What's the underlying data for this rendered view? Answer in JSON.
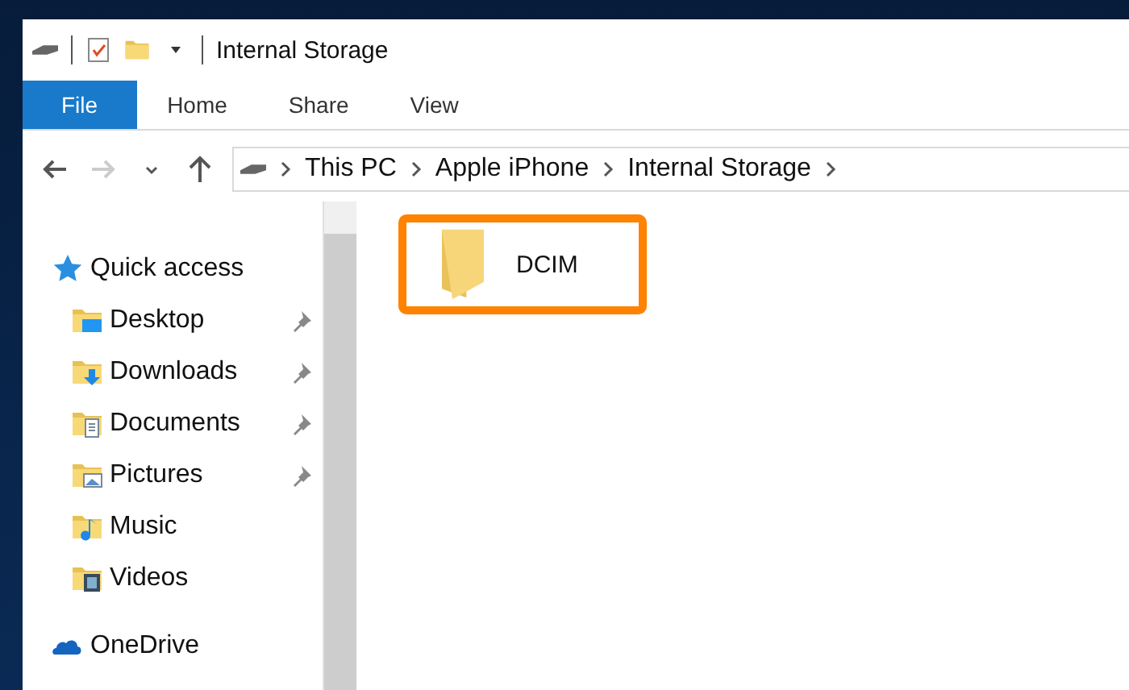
{
  "window": {
    "title": "Internal Storage"
  },
  "ribbon_tabs": [
    {
      "label": "File",
      "selected": true
    },
    {
      "label": "Home",
      "selected": false
    },
    {
      "label": "Share",
      "selected": false
    },
    {
      "label": "View",
      "selected": false
    }
  ],
  "breadcrumb": [
    "This PC",
    "Apple iPhone",
    "Internal Storage"
  ],
  "sidebar": {
    "items": [
      {
        "label": "Quick access",
        "kind": "star",
        "pinned": false,
        "children": [
          {
            "label": "Desktop",
            "kind": "desktop",
            "pinned": true
          },
          {
            "label": "Downloads",
            "kind": "downloads",
            "pinned": true
          },
          {
            "label": "Documents",
            "kind": "documents",
            "pinned": true
          },
          {
            "label": "Pictures",
            "kind": "pictures",
            "pinned": true
          },
          {
            "label": "Music",
            "kind": "music",
            "pinned": false
          },
          {
            "label": "Videos",
            "kind": "videos",
            "pinned": false
          }
        ]
      },
      {
        "label": "OneDrive",
        "kind": "cloud",
        "pinned": false
      }
    ]
  },
  "files": [
    {
      "name": "DCIM",
      "highlighted": true
    }
  ]
}
